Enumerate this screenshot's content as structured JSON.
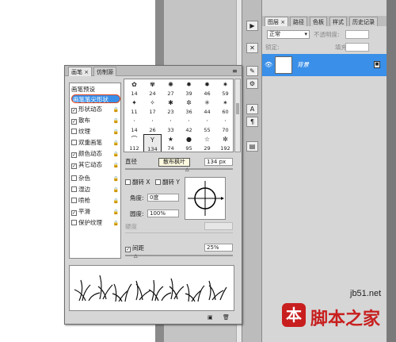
{
  "brush_panel": {
    "tabs": [
      {
        "label": "画笔 ×"
      },
      {
        "label": "仿制源"
      }
    ],
    "menu_icon": "panel-menu-icon",
    "options": [
      {
        "label": "画笔预设",
        "checked": false,
        "lockable": false
      },
      {
        "label": "画笔笔尖形状",
        "checked": false,
        "lockable": false,
        "selected": true
      },
      {
        "label": "形状动态",
        "checked": true,
        "lockable": true
      },
      {
        "label": "散布",
        "checked": true,
        "lockable": true
      },
      {
        "label": "纹理",
        "checked": false,
        "lockable": true
      },
      {
        "label": "双重画笔",
        "checked": false,
        "lockable": true
      },
      {
        "label": "颜色动态",
        "checked": true,
        "lockable": true
      },
      {
        "label": "其它动态",
        "checked": true,
        "lockable": true
      },
      {
        "label": "杂色",
        "checked": false,
        "lockable": true
      },
      {
        "label": "湿边",
        "checked": false,
        "lockable": true
      },
      {
        "label": "喷枪",
        "checked": false,
        "lockable": true
      },
      {
        "label": "平滑",
        "checked": true,
        "lockable": true
      },
      {
        "label": "保护纹理",
        "checked": false,
        "lockable": true
      }
    ],
    "tips_rows": [
      [
        "14",
        "24",
        "27",
        "39",
        "46",
        "59"
      ],
      [
        "11",
        "17",
        "23",
        "36",
        "44",
        "60"
      ],
      [
        "14",
        "26",
        "33",
        "42",
        "55",
        "70"
      ],
      [
        "112",
        "134",
        "74",
        "95",
        "29",
        "192"
      ]
    ],
    "selected_tip_label": "134",
    "tooltip": "散布枫叶",
    "diameter_label": "直径",
    "diameter_value": "134 px",
    "flip_x": "翻转 X",
    "flip_y": "翻转 Y",
    "angle_label": "角度:",
    "angle_value": "0度",
    "roundness_label": "圆度:",
    "roundness_value": "100%",
    "hardness_label": "硬度",
    "spacing_label": "间距",
    "spacing_value": "25%",
    "spacing_checked": true
  },
  "layers_panel": {
    "tabs": [
      {
        "label": "图层 ×"
      },
      {
        "label": "路径"
      },
      {
        "label": "色板"
      },
      {
        "label": "样式"
      },
      {
        "label": "历史记录"
      }
    ],
    "blend_mode": "正常",
    "opacity_label": "不透明度:",
    "lock_label": "锁定:",
    "fill_label": "填充:",
    "layer_name": "背景"
  },
  "watermark": {
    "site": "jb51.net",
    "brand": "脚本之家"
  },
  "colors": {
    "selection": "#3a8fe8",
    "ellipse": "#e0441a"
  }
}
